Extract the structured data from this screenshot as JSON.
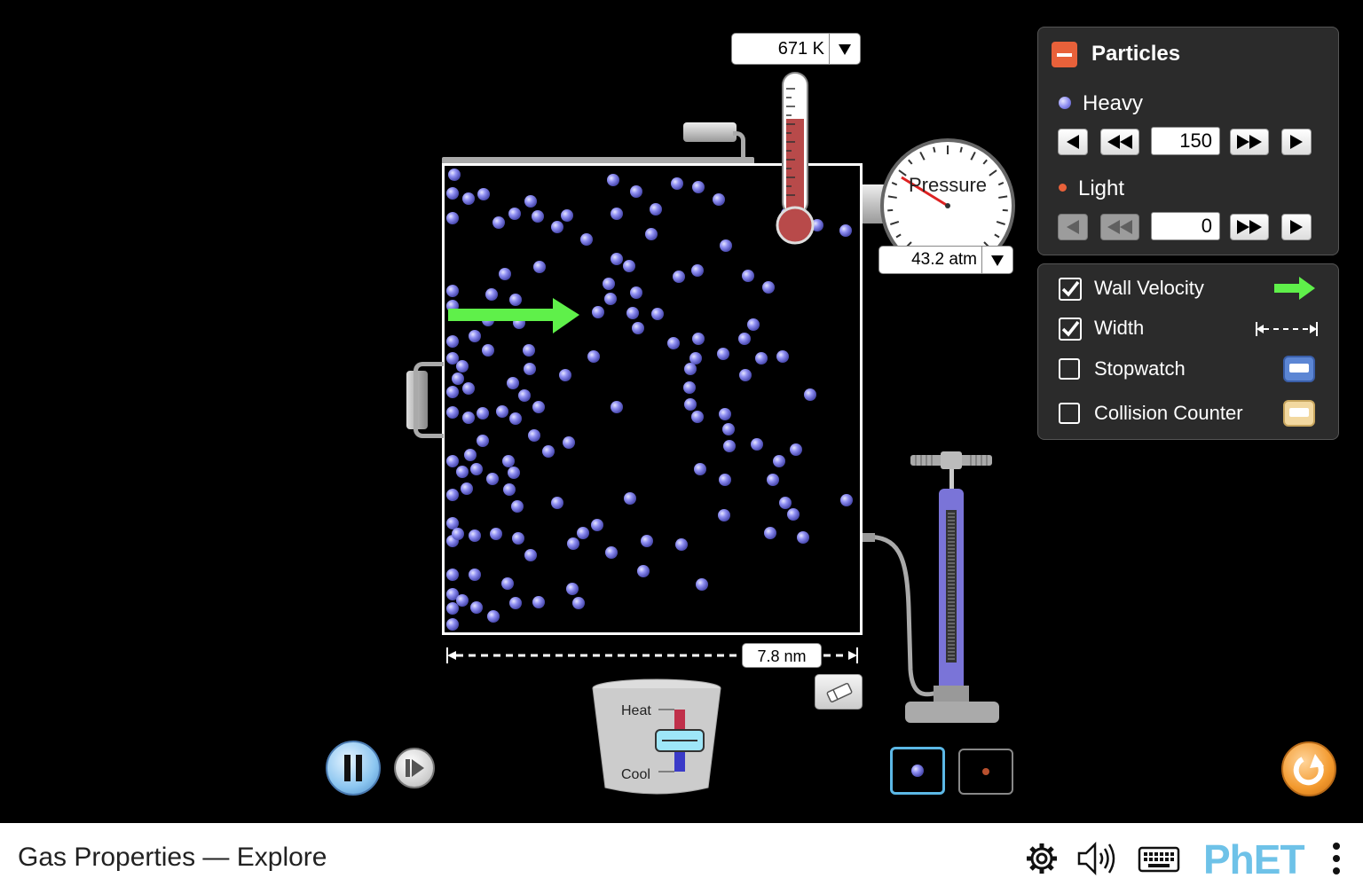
{
  "app": {
    "title": "Gas Properties — Explore"
  },
  "thermometer": {
    "readout": "671 K"
  },
  "gauge": {
    "label": "Pressure",
    "readout": "43.2 atm"
  },
  "container": {
    "width_readout": "7.8 nm"
  },
  "heater": {
    "heat_label": "Heat",
    "cool_label": "Cool"
  },
  "particles_panel": {
    "title": "Particles",
    "heavy": {
      "label": "Heavy",
      "value": "150",
      "color": "#8f8ff2"
    },
    "light": {
      "label": "Light",
      "value": "0",
      "color": "#e8613a"
    }
  },
  "options_panel": {
    "items": [
      {
        "label": "Wall Velocity",
        "checked": true,
        "icon": "green-arrow-icon"
      },
      {
        "label": "Width",
        "checked": true,
        "icon": "width-icon"
      },
      {
        "label": "Stopwatch",
        "checked": false,
        "icon": "stopwatch-icon"
      },
      {
        "label": "Collision Counter",
        "checked": false,
        "icon": "collision-counter-icon"
      }
    ]
  },
  "colors": {
    "accent": "#e8613a",
    "particle": "#8f8ff2",
    "wall_arrow": "#5ff04a",
    "reset": "#f39a2e"
  },
  "navbar": {
    "brand": "PhET"
  }
}
